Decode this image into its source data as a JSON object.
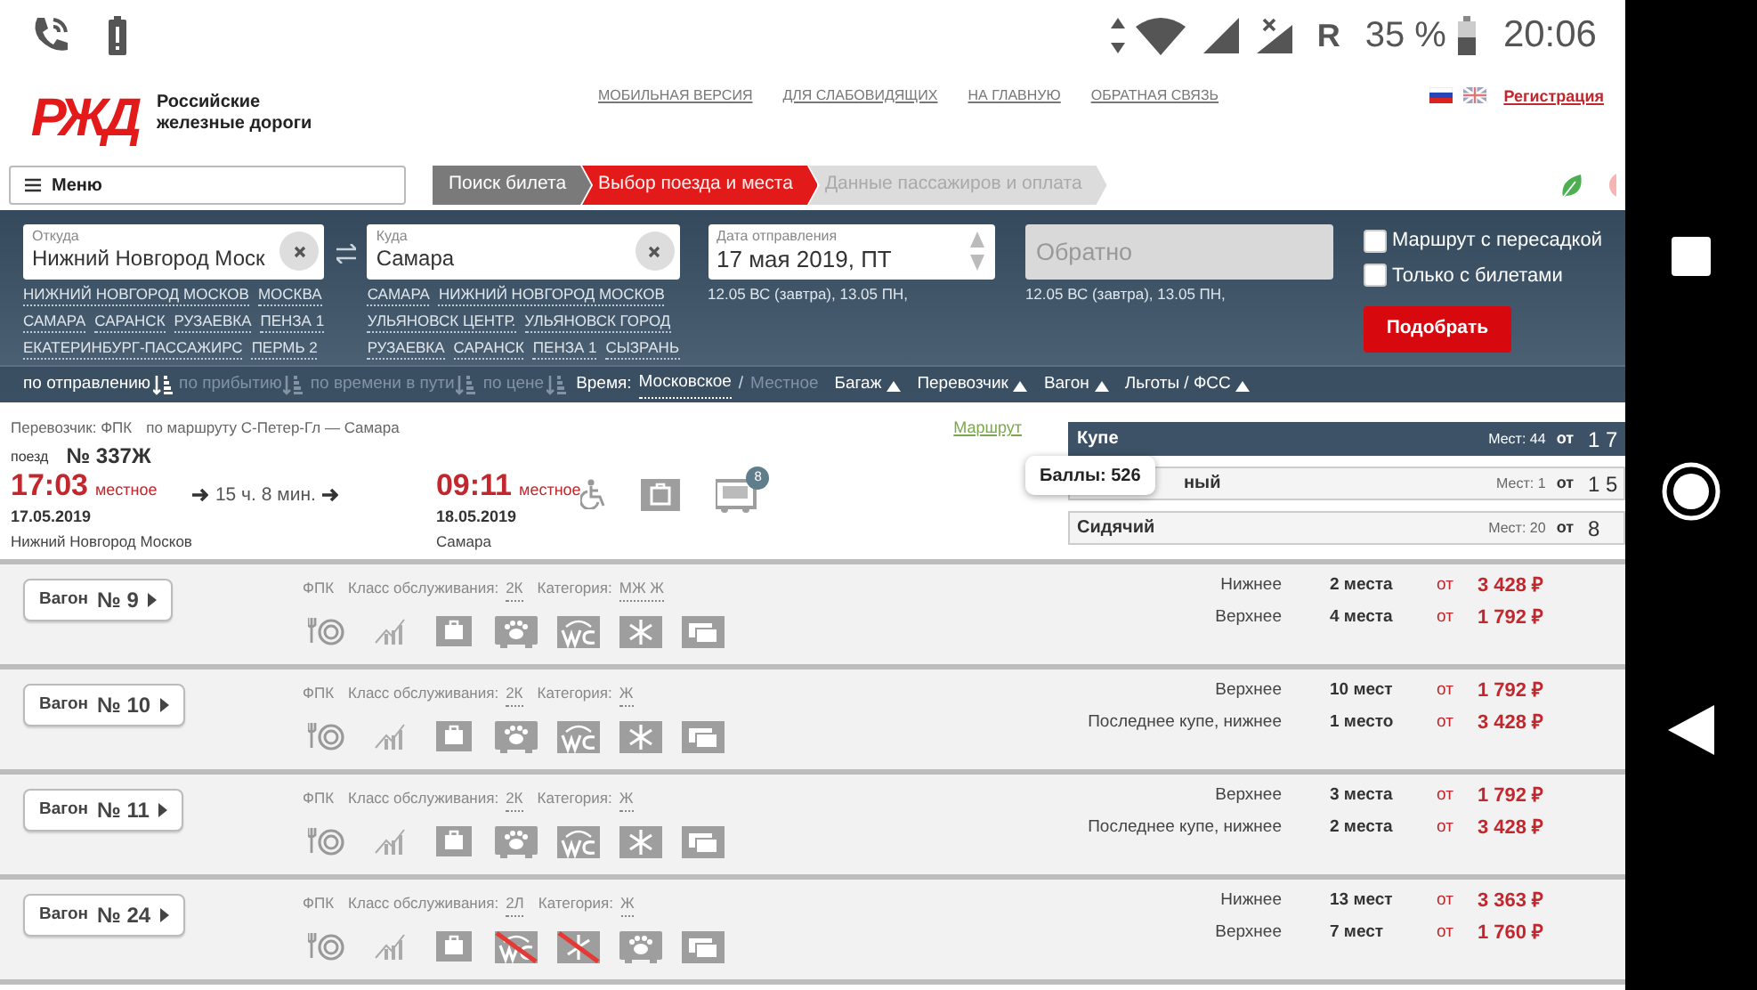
{
  "status_bar": {
    "roaming": "R",
    "battery": "35 %",
    "time": "20:06"
  },
  "header": {
    "logo": "РЖД",
    "brand": "Российские железные дороги",
    "links": [
      "МОБИЛЬНАЯ ВЕРСИЯ",
      "ДЛЯ СЛАБОВИДЯЩИХ",
      "НА ГЛАВНУЮ",
      "ОБРАТНАЯ СВЯЗЬ"
    ],
    "register": "Регистрация"
  },
  "menu": {
    "label": "Меню"
  },
  "steps": [
    {
      "label": "Поиск билета",
      "completed": true,
      "selected": false
    },
    {
      "label": "Выбор поезда и места",
      "completed": false,
      "selected": true
    },
    {
      "label": "Данные пассажиров и оплата",
      "completed": false,
      "selected": false
    }
  ],
  "search": {
    "from": {
      "label": "Откуда",
      "value": "Нижний Новгород Моск",
      "suggestions": [
        [
          "НИЖНИЙ НОВГОРОД МОСКОВ",
          "МОСКВА"
        ],
        [
          "САМАРА",
          "САРАНСК",
          "РУЗАЕВКА",
          "ПЕНЗА 1"
        ],
        [
          "ЕКАТЕРИНБУРГ-ПАССАЖИРС",
          "ПЕРМЬ 2"
        ]
      ]
    },
    "to": {
      "label": "Куда",
      "value": "Самара",
      "suggestions": [
        [
          "САМАРА",
          "НИЖНИЙ НОВГОРОД МОСКОВ"
        ],
        [
          "УЛЬЯНОВСК ЦЕНТР.",
          "УЛЬЯНОВСК ГОРОД"
        ],
        [
          "РУЗАЕВКА",
          "САРАНСК",
          "ПЕНЗА 1",
          "СЫЗРАНЬ"
        ]
      ]
    },
    "date": {
      "label": "Дата отправления",
      "value": "17 мая 2019, ПТ",
      "hints": "12.05 ВС (завтра), 13.05 ПН,"
    },
    "return": {
      "placeholder": "Обратно",
      "disabled": true,
      "hints": "12.05 ВС (завтра), 13.05 ПН,"
    },
    "options": [
      {
        "label": "Маршрут с пересадкой",
        "checked": false
      },
      {
        "label": "Только с билетами",
        "checked": false
      }
    ],
    "submit": "Подобрать"
  },
  "sorting": {
    "items": [
      {
        "label": "по отправлению",
        "selected": true
      },
      {
        "label": "по прибытию",
        "selected": false
      },
      {
        "label": "по времени в пути",
        "selected": false
      },
      {
        "label": "по цене",
        "selected": false
      }
    ],
    "time_label": "Время:",
    "time_separator": "/",
    "time_modes": [
      {
        "label": "Московское",
        "selected": true
      },
      {
        "label": "Местное",
        "selected": false
      }
    ],
    "filters": [
      "Багаж",
      "Перевозчик",
      "Вагон",
      "Льготы / ФСС"
    ]
  },
  "train": {
    "carrier": "Перевозчик: ФПК",
    "route": "по маршруту С-Петер-Гл — Самара",
    "route_link": "Маршрут",
    "train_label": "поезд",
    "number": "№ 337Ж",
    "departure": {
      "time": "17:03",
      "zone": "местное",
      "date": "17.05.2019",
      "station": "Нижний Новгород Москов"
    },
    "duration": "15 ч. 8 мин.",
    "arrival": {
      "time": "09:11",
      "zone": "местное",
      "date": "18.05.2019",
      "station": "Самара"
    },
    "wagon_count": "8",
    "tooltip": "Баллы: 526",
    "classes": [
      {
        "name": "Купе",
        "seats": "Мест: 44",
        "from": "от",
        "price": "1 7",
        "selected": true
      },
      {
        "name": "ный",
        "seats": "Мест: 1",
        "from": "от",
        "price": "1 5",
        "selected": false
      },
      {
        "name": "Сидячий",
        "seats": "Мест: 20",
        "from": "от",
        "price": "8",
        "selected": false
      }
    ]
  },
  "wagons": [
    {
      "label": "Вагон",
      "number": "№ 9",
      "carrier": "ФПК",
      "service": "Класс обслуживания:",
      "service_value": "2К",
      "category": "Категория:",
      "category_value": "МЖ Ж",
      "amenities": [
        {
          "kind": "dining",
          "unavailable": false
        },
        {
          "kind": "chart",
          "unavailable": false
        },
        {
          "kind": "bag",
          "unavailable": false
        },
        {
          "kind": "pet",
          "unavailable": false
        },
        {
          "kind": "wc",
          "unavailable": false
        },
        {
          "kind": "snow",
          "unavailable": false
        },
        {
          "kind": "tv",
          "unavailable": false
        }
      ],
      "seats": [
        {
          "type": "Нижнее",
          "count": "2 места",
          "from": "от",
          "price": "3 428 ₽"
        },
        {
          "type": "Верхнее",
          "count": "4 места",
          "from": "от",
          "price": "1 792 ₽"
        }
      ]
    },
    {
      "label": "Вагон",
      "number": "№ 10",
      "carrier": "ФПК",
      "service": "Класс обслуживания:",
      "service_value": "2К",
      "category": "Категория:",
      "category_value": "Ж",
      "amenities": [
        {
          "kind": "dining",
          "unavailable": false
        },
        {
          "kind": "chart",
          "unavailable": false
        },
        {
          "kind": "bag",
          "unavailable": false
        },
        {
          "kind": "pet",
          "unavailable": false
        },
        {
          "kind": "wc",
          "unavailable": false
        },
        {
          "kind": "snow",
          "unavailable": false
        },
        {
          "kind": "tv",
          "unavailable": false
        }
      ],
      "seats": [
        {
          "type": "Верхнее",
          "count": "10 мест",
          "from": "от",
          "price": "1 792 ₽"
        },
        {
          "type": "Последнее купе, нижнее",
          "count": "1 место",
          "from": "от",
          "price": "3 428 ₽"
        }
      ]
    },
    {
      "label": "Вагон",
      "number": "№ 11",
      "carrier": "ФПК",
      "service": "Класс обслуживания:",
      "service_value": "2К",
      "category": "Категория:",
      "category_value": "Ж",
      "amenities": [
        {
          "kind": "dining",
          "unavailable": false
        },
        {
          "kind": "chart",
          "unavailable": false
        },
        {
          "kind": "bag",
          "unavailable": false
        },
        {
          "kind": "pet",
          "unavailable": false
        },
        {
          "kind": "wc",
          "unavailable": false
        },
        {
          "kind": "snow",
          "unavailable": false
        },
        {
          "kind": "tv",
          "unavailable": false
        }
      ],
      "seats": [
        {
          "type": "Верхнее",
          "count": "3 места",
          "from": "от",
          "price": "1 792 ₽"
        },
        {
          "type": "Последнее купе, нижнее",
          "count": "2 места",
          "from": "от",
          "price": "3 428 ₽"
        }
      ]
    },
    {
      "label": "Вагон",
      "number": "№ 24",
      "carrier": "ФПК",
      "service": "Класс обслуживания:",
      "service_value": "2Л",
      "category": "Категория:",
      "category_value": "Ж",
      "amenities": [
        {
          "kind": "dining",
          "unavailable": false
        },
        {
          "kind": "chart",
          "unavailable": false
        },
        {
          "kind": "bag",
          "unavailable": false
        },
        {
          "kind": "wc",
          "unavailable": true
        },
        {
          "kind": "snow",
          "unavailable": true
        },
        {
          "kind": "pet",
          "unavailable": false
        },
        {
          "kind": "tv",
          "unavailable": false
        }
      ],
      "seats": [
        {
          "type": "Нижнее",
          "count": "13 мест",
          "from": "от",
          "price": "3 363 ₽"
        },
        {
          "type": "Верхнее",
          "count": "7 мест",
          "from": "от",
          "price": "1 760 ₽"
        }
      ]
    }
  ]
}
